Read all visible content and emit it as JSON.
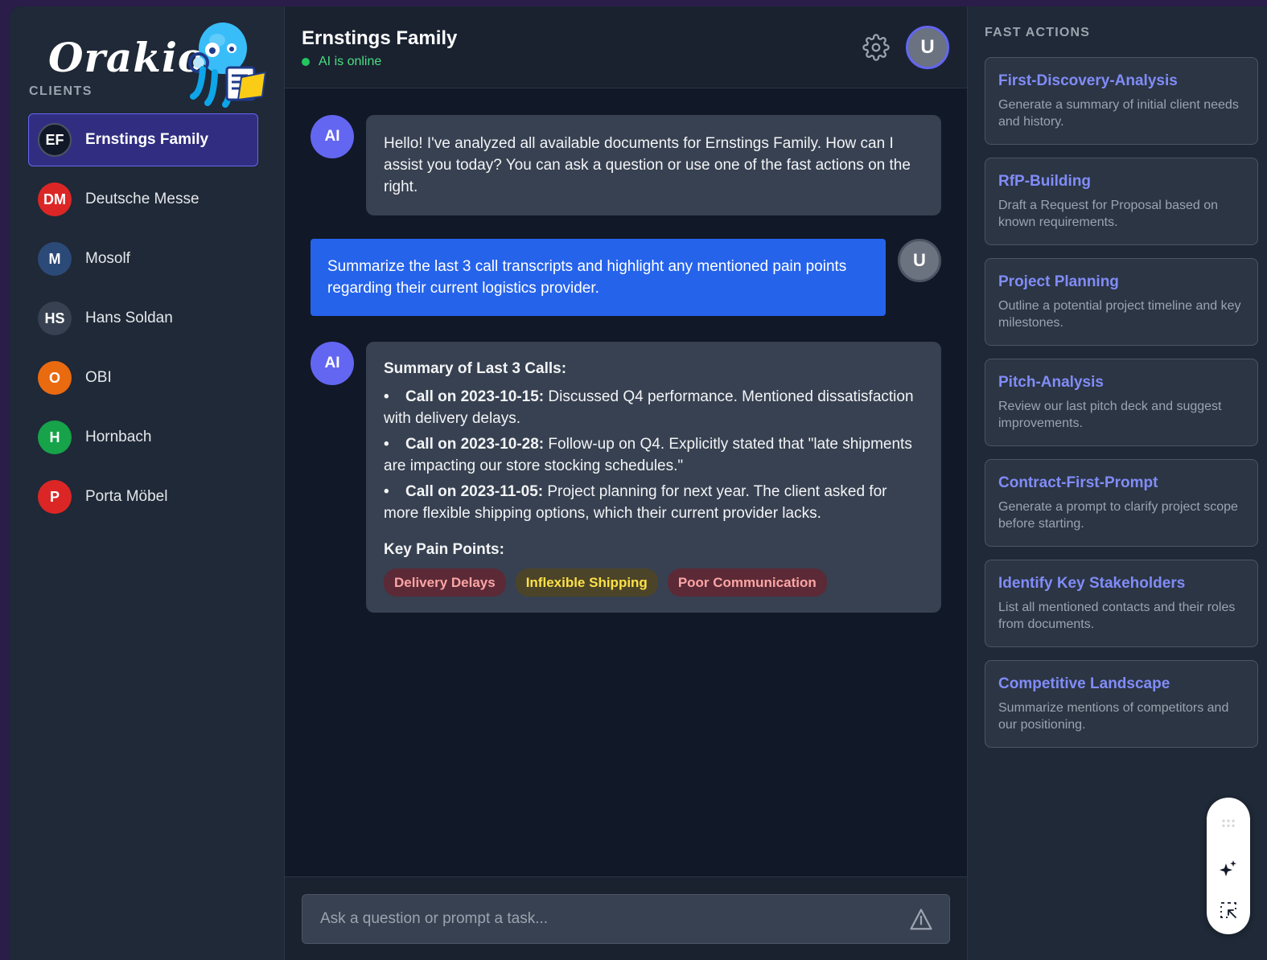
{
  "brand": {
    "logo_text": "Orakio"
  },
  "sidebar": {
    "section_label": "CLIENTS",
    "clients": [
      {
        "initials": "EF",
        "name": "Ernstings Family",
        "color": "#111827",
        "active": true
      },
      {
        "initials": "DM",
        "name": "Deutsche Messe",
        "color": "#dc2626"
      },
      {
        "initials": "M",
        "name": "Mosolf",
        "color": "#2c4a78"
      },
      {
        "initials": "HS",
        "name": "Hans Soldan",
        "color": "#374151"
      },
      {
        "initials": "O",
        "name": "OBI",
        "color": "#ea6a10"
      },
      {
        "initials": "H",
        "name": "Hornbach",
        "color": "#16a34a"
      },
      {
        "initials": "P",
        "name": "Porta Möbel",
        "color": "#dc2626"
      }
    ]
  },
  "header": {
    "title": "Ernstings Family",
    "status": "AI is online",
    "user_initial": "U"
  },
  "messages": {
    "ai_label": "AI",
    "user_initial": "U",
    "greeting": "Hello! I've analyzed all available documents for Ernstings Family. How can I assist you today? You can ask a question or use one of the fast actions on the right.",
    "user_prompt": "Summarize the last 3 call transcripts and highlight any mentioned pain points regarding their current logistics provider.",
    "summary": {
      "title": "Summary of Last 3 Calls:",
      "bullet": "•",
      "items": [
        {
          "label": "Call on 2023-10-15:",
          "text": " Discussed Q4 performance. Mentioned dissatisfaction with delivery delays."
        },
        {
          "label": "Call on 2023-10-28:",
          "text": " Follow-up on Q4. Explicitly stated that \"late shipments are impacting our store stocking schedules.\""
        },
        {
          "label": "Call on 2023-11-05:",
          "text": " Project planning for next year. The client asked for more flexible shipping options, which their current provider lacks."
        }
      ],
      "pain_title": "Key Pain Points:",
      "tags": [
        "Delivery Delays",
        "Inflexible Shipping",
        "Poor Communication"
      ]
    }
  },
  "input": {
    "placeholder": "Ask a question or prompt a task..."
  },
  "fast_actions": {
    "label": "FAST ACTIONS",
    "items": [
      {
        "title": "First-Discovery-Analysis",
        "desc": "Generate a summary of initial client needs and history."
      },
      {
        "title": "RfP-Building",
        "desc": "Draft a Request for Proposal based on known requirements."
      },
      {
        "title": "Project Planning",
        "desc": "Outline a potential project timeline and key milestones."
      },
      {
        "title": "Pitch-Analysis",
        "desc": "Review our last pitch deck and suggest improvements."
      },
      {
        "title": "Contract-First-Prompt",
        "desc": "Generate a prompt to clarify project scope before starting."
      },
      {
        "title": "Identify Key Stakeholders",
        "desc": "List all mentioned contacts and their roles from documents."
      },
      {
        "title": "Competitive Landscape",
        "desc": "Summarize mentions of competitors and our positioning."
      }
    ]
  },
  "icons": {
    "settings": "gear-icon",
    "send": "send-icon",
    "drag": "drag-handle-icon",
    "sparkle": "sparkle-icon",
    "select": "select-region-icon"
  }
}
